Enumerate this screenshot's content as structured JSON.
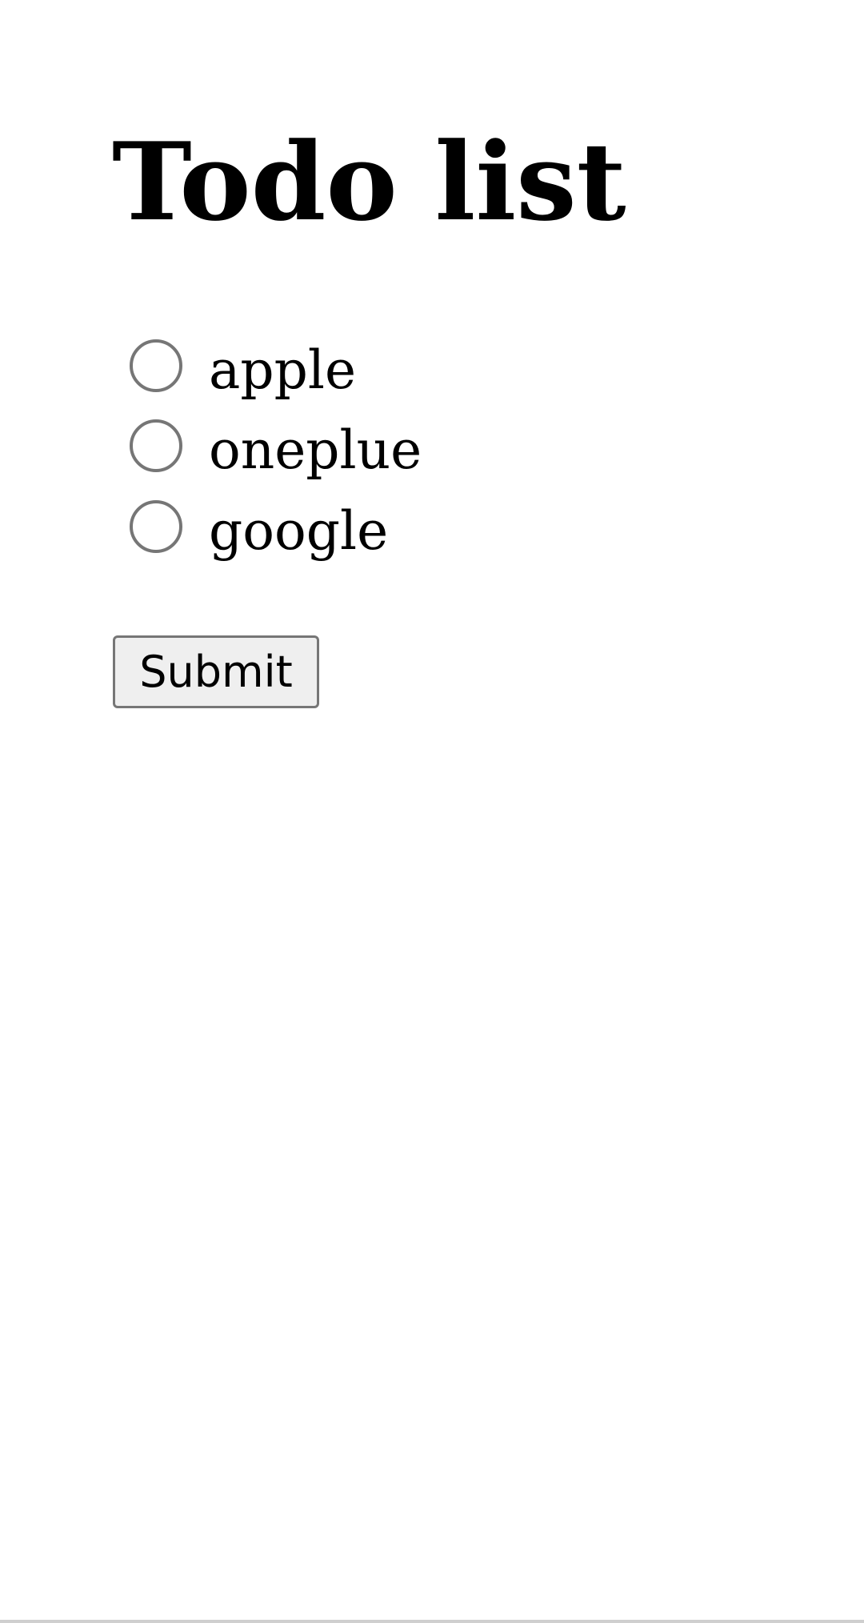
{
  "page": {
    "title": "Todo list"
  },
  "options": [
    {
      "label": "apple",
      "selected": false
    },
    {
      "label": "oneplue",
      "selected": false
    },
    {
      "label": "google",
      "selected": false
    }
  ],
  "form": {
    "submit_label": "Submit"
  }
}
